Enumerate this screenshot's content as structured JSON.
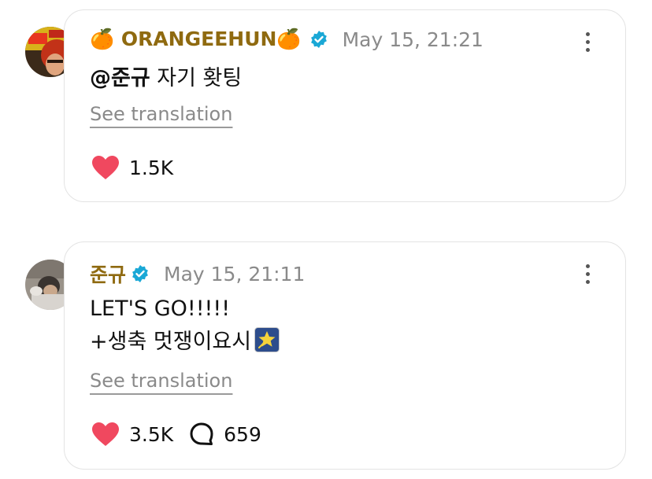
{
  "posts": [
    {
      "username": "🍊 ORANGEEHUN🍊",
      "time": "May 15, 21:21",
      "mention": "@준규",
      "text": " 자기 홧팅",
      "see_translation": "See translation",
      "likes": "1.5K"
    },
    {
      "username": "준규",
      "time": "May 15, 21:11",
      "line1": "LET'S GO!!!!!",
      "line2": "+생축 멋쟁이요시",
      "see_translation": "See translation",
      "likes": "3.5K",
      "comments": "659"
    }
  ],
  "colors": {
    "username": "#8f6a10",
    "verified": "#1aa8d6",
    "heart": "#f0485f",
    "muted": "#8a8a8a",
    "card_border": "#e3e3e3"
  },
  "icons": [
    "verified-badge-icon",
    "more-options-icon",
    "heart-icon",
    "comment-icon",
    "glowing-star-icon"
  ]
}
